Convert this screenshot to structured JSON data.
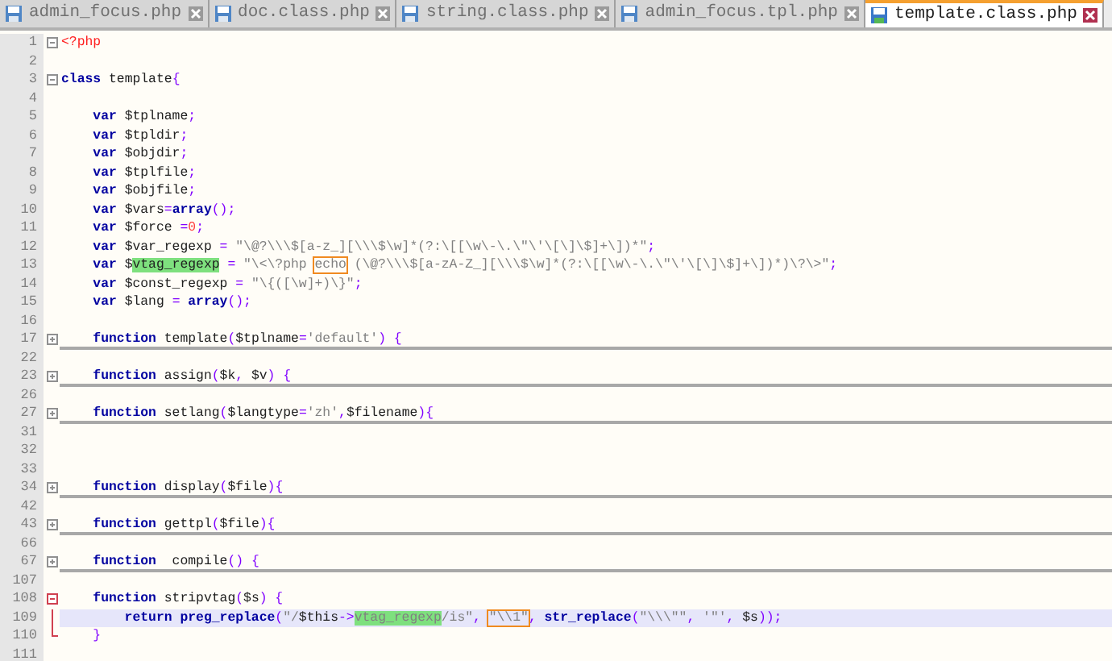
{
  "tabs": [
    {
      "label": "admin_focus.php",
      "selected": false
    },
    {
      "label": "doc.class.php",
      "selected": false
    },
    {
      "label": "string.class.php",
      "selected": false
    },
    {
      "label": "admin_focus.tpl.php",
      "selected": false
    },
    {
      "label": "template.class.php",
      "selected": true
    }
  ],
  "lines": [
    {
      "number": "1",
      "kind": "foldstart",
      "tokens": [
        {
          "kind": "tag",
          "text": "<?php"
        }
      ]
    },
    {
      "number": "2",
      "kind": "plain"
    },
    {
      "number": "3",
      "kind": "foldstart",
      "tokens": [
        {
          "kind": "keyword",
          "text": "class"
        },
        {
          "kind": "plain",
          "text": " template"
        },
        {
          "kind": "op",
          "text": "{"
        }
      ]
    },
    {
      "number": "4",
      "kind": "plain"
    },
    {
      "number": "5",
      "kind": "plain",
      "tokens": [
        {
          "kind": "keyword",
          "text": "    var"
        },
        {
          "kind": "plain",
          "text": " $tplname"
        },
        {
          "kind": "op",
          "text": ";"
        }
      ]
    },
    {
      "number": "6",
      "kind": "plain",
      "tokens": [
        {
          "kind": "keyword",
          "text": "    var"
        },
        {
          "kind": "plain",
          "text": " $tpldir"
        },
        {
          "kind": "op",
          "text": ";"
        }
      ]
    },
    {
      "number": "7",
      "kind": "plain",
      "tokens": [
        {
          "kind": "keyword",
          "text": "    var"
        },
        {
          "kind": "plain",
          "text": " $objdir"
        },
        {
          "kind": "op",
          "text": ";"
        }
      ]
    },
    {
      "number": "8",
      "kind": "plain",
      "tokens": [
        {
          "kind": "keyword",
          "text": "    var"
        },
        {
          "kind": "plain",
          "text": " $tplfile"
        },
        {
          "kind": "op",
          "text": ";"
        }
      ]
    },
    {
      "number": "9",
      "kind": "plain",
      "tokens": [
        {
          "kind": "keyword",
          "text": "    var"
        },
        {
          "kind": "plain",
          "text": " $objfile"
        },
        {
          "kind": "op",
          "text": ";"
        }
      ]
    },
    {
      "number": "10",
      "kind": "plain",
      "tokens": [
        {
          "kind": "keyword",
          "text": "    var"
        },
        {
          "kind": "plain",
          "text": " $vars"
        },
        {
          "kind": "op",
          "text": "="
        },
        {
          "kind": "keyword",
          "text": "array"
        },
        {
          "kind": "op",
          "text": "();"
        }
      ]
    },
    {
      "number": "11",
      "kind": "plain",
      "tokens": [
        {
          "kind": "keyword",
          "text": "    var"
        },
        {
          "kind": "plain",
          "text": " $force "
        },
        {
          "kind": "op",
          "text": "="
        },
        {
          "kind": "number",
          "text": "0"
        },
        {
          "kind": "op",
          "text": ";"
        }
      ]
    },
    {
      "number": "12",
      "kind": "plain",
      "tokens": [
        {
          "kind": "keyword",
          "text": "    var"
        },
        {
          "kind": "plain",
          "text": " $var_regexp "
        },
        {
          "kind": "op",
          "text": "="
        },
        {
          "kind": "string",
          "text": " \"\\@?\\\\\\$[a-z_][\\\\\\$\\w]*(?:\\[[\\w\\-\\.\\\"\\'\\[\\]\\$]+\\])*\""
        },
        {
          "kind": "op",
          "text": ";"
        }
      ]
    },
    {
      "number": "13",
      "kind": "plain",
      "tokens": [
        {
          "kind": "keyword",
          "text": "    var"
        },
        {
          "kind": "plain",
          "text": " $"
        },
        {
          "kind": "plain",
          "text": "vtag_regexp",
          "highlight": true
        },
        {
          "kind": "op",
          "text": " ="
        },
        {
          "kind": "string",
          "text": " \"\\<\\?php "
        },
        {
          "kind": "string",
          "text": "echo",
          "boxed": true
        },
        {
          "kind": "string",
          "text": " (\\@?\\\\\\$[a-zA-Z_][\\\\\\$\\w]*(?:\\[[\\w\\-\\.\\\"\\'\\[\\]\\$]+\\])*)\\?\\>\""
        },
        {
          "kind": "op",
          "text": ";"
        }
      ]
    },
    {
      "number": "14",
      "kind": "plain",
      "tokens": [
        {
          "kind": "keyword",
          "text": "    var"
        },
        {
          "kind": "plain",
          "text": " $const_regexp "
        },
        {
          "kind": "op",
          "text": "="
        },
        {
          "kind": "string",
          "text": " \"\\{([\\w]+)\\}\""
        },
        {
          "kind": "op",
          "text": ";"
        }
      ]
    },
    {
      "number": "15",
      "kind": "plain",
      "tokens": [
        {
          "kind": "keyword",
          "text": "    var"
        },
        {
          "kind": "plain",
          "text": " $lang "
        },
        {
          "kind": "op",
          "text": "="
        },
        {
          "kind": "keyword",
          "text": " array"
        },
        {
          "kind": "op",
          "text": "();"
        }
      ]
    },
    {
      "number": "16",
      "kind": "plain"
    },
    {
      "number": "17",
      "kind": "folded",
      "tokens": [
        {
          "kind": "keyword",
          "text": "    function"
        },
        {
          "kind": "plain",
          "text": " template"
        },
        {
          "kind": "op",
          "text": "("
        },
        {
          "kind": "plain",
          "text": "$tplname"
        },
        {
          "kind": "op",
          "text": "="
        },
        {
          "kind": "string",
          "text": "'default'"
        },
        {
          "kind": "op",
          "text": ") {"
        }
      ]
    },
    {
      "number": "22",
      "kind": "plain"
    },
    {
      "number": "23",
      "kind": "folded",
      "tokens": [
        {
          "kind": "keyword",
          "text": "    function"
        },
        {
          "kind": "plain",
          "text": " assign"
        },
        {
          "kind": "op",
          "text": "("
        },
        {
          "kind": "plain",
          "text": "$k"
        },
        {
          "kind": "op",
          "text": ","
        },
        {
          "kind": "plain",
          "text": " $v"
        },
        {
          "kind": "op",
          "text": ") {"
        }
      ]
    },
    {
      "number": "26",
      "kind": "plain"
    },
    {
      "number": "27",
      "kind": "folded",
      "tokens": [
        {
          "kind": "keyword",
          "text": "    function"
        },
        {
          "kind": "plain",
          "text": " setlang"
        },
        {
          "kind": "op",
          "text": "("
        },
        {
          "kind": "plain",
          "text": "$langtype"
        },
        {
          "kind": "op",
          "text": "="
        },
        {
          "kind": "string",
          "text": "'zh'"
        },
        {
          "kind": "op",
          "text": ","
        },
        {
          "kind": "plain",
          "text": "$filename"
        },
        {
          "kind": "op",
          "text": "){"
        }
      ]
    },
    {
      "number": "31",
      "kind": "plain"
    },
    {
      "number": "32",
      "kind": "plain"
    },
    {
      "number": "33",
      "kind": "plain"
    },
    {
      "number": "34",
      "kind": "folded",
      "tokens": [
        {
          "kind": "keyword",
          "text": "    function"
        },
        {
          "kind": "plain",
          "text": " display"
        },
        {
          "kind": "op",
          "text": "("
        },
        {
          "kind": "plain",
          "text": "$file"
        },
        {
          "kind": "op",
          "text": "){"
        }
      ]
    },
    {
      "number": "42",
      "kind": "plain"
    },
    {
      "number": "43",
      "kind": "folded",
      "tokens": [
        {
          "kind": "keyword",
          "text": "    function"
        },
        {
          "kind": "plain",
          "text": " gettpl"
        },
        {
          "kind": "op",
          "text": "("
        },
        {
          "kind": "plain",
          "text": "$file"
        },
        {
          "kind": "op",
          "text": "){"
        }
      ]
    },
    {
      "number": "66",
      "kind": "plain"
    },
    {
      "number": "67",
      "kind": "folded",
      "tokens": [
        {
          "kind": "keyword",
          "text": "    function"
        },
        {
          "kind": "plain",
          "text": "  compile"
        },
        {
          "kind": "op",
          "text": "() {"
        }
      ]
    },
    {
      "number": "107",
      "kind": "plain"
    },
    {
      "number": "108",
      "kind": "blockstart",
      "tokens": [
        {
          "kind": "keyword",
          "text": "    function"
        },
        {
          "kind": "plain",
          "text": " stripvtag"
        },
        {
          "kind": "op",
          "text": "("
        },
        {
          "kind": "plain",
          "text": "$s"
        },
        {
          "kind": "op",
          "text": ") {"
        }
      ]
    },
    {
      "number": "109",
      "kind": "blockbody",
      "current": true,
      "tokens": [
        {
          "kind": "keyword",
          "text": "        return"
        },
        {
          "kind": "keyword",
          "text": " preg_replace"
        },
        {
          "kind": "op",
          "text": "("
        },
        {
          "kind": "string",
          "text": "\"/"
        },
        {
          "kind": "plain",
          "text": "$this"
        },
        {
          "kind": "op",
          "text": "->"
        },
        {
          "kind": "string",
          "text": "vtag_regexp",
          "highlight": true
        },
        {
          "kind": "string",
          "text": "/is\""
        },
        {
          "kind": "op",
          "text": ", "
        },
        {
          "kind": "string",
          "text": "\"\\\\1\"",
          "boxed": true
        },
        {
          "kind": "op",
          "text": ", "
        },
        {
          "kind": "keyword",
          "text": "str_replace"
        },
        {
          "kind": "op",
          "text": "("
        },
        {
          "kind": "string",
          "text": "\"\\\\\\\"\""
        },
        {
          "kind": "op",
          "text": ", "
        },
        {
          "kind": "string",
          "text": "'\"'"
        },
        {
          "kind": "op",
          "text": ","
        },
        {
          "kind": "plain",
          "text": " $s"
        },
        {
          "kind": "op",
          "text": "));"
        }
      ]
    },
    {
      "number": "110",
      "kind": "blockend",
      "tokens": [
        {
          "kind": "op",
          "text": "    }"
        }
      ]
    },
    {
      "number": "111",
      "kind": "plain"
    }
  ]
}
